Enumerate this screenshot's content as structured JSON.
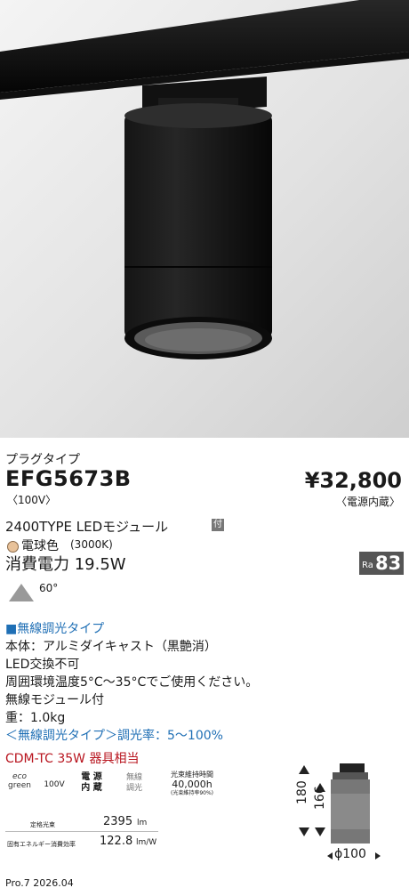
{
  "product": {
    "type_label": "プラグタイプ",
    "model": "EFG5673B",
    "voltage": "〈100V〉",
    "price": "¥32,800",
    "price_note": "〈電源内蔵〉"
  },
  "module": {
    "name": "2400TYPE LEDモジュール",
    "badge": "付",
    "color_name": "電球色",
    "color_temp": "(3000K)",
    "power": "消費電力 19.5W",
    "ra_label": "Ra",
    "ra_value": "83",
    "beam_angle": "60°"
  },
  "features": {
    "heading": "■無線調光タイプ",
    "lines": [
      "本体：アルミダイキャスト（黒艶消）",
      "LED交換不可",
      "周囲環境温度5°C～35°Cでご使用ください。",
      "無線モジュール付",
      "重：1.0kg"
    ],
    "dimming": "＜無線調光タイプ＞調光率：5～100%",
    "equivalent": "CDM-TC 35W 器具相当"
  },
  "spec_icons": {
    "eco_top": "eco",
    "eco_bottom": "green",
    "voltage": "100V",
    "power_supply_1": "電 源",
    "power_supply_2": "内 蔵",
    "wireless_1": "無線",
    "wireless_2": "調光",
    "life_label": "光束維持時間",
    "life_value": "40,000h",
    "life_note": "(光束維持率90%)"
  },
  "ratings": {
    "rated_flux_label": "定格光束",
    "rated_flux_value": "2395",
    "rated_flux_unit": "lm",
    "efficiency_label": "固有エネルギー消費効率",
    "efficiency_value": "122.8",
    "efficiency_unit": "lm/W"
  },
  "dimensions": {
    "height_total": "180",
    "height_body": "166",
    "diameter": "ϕ100"
  },
  "footer": "Pro.7 2026.04"
}
